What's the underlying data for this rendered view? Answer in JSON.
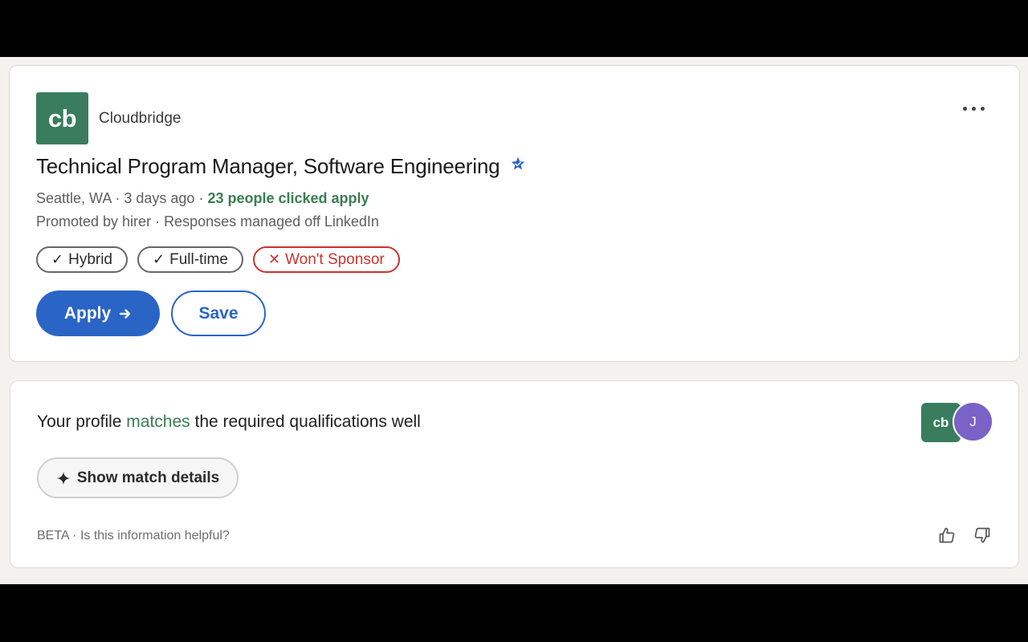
{
  "colors": {
    "brand_green": "#3a7d5e",
    "accent_green": "#3a7d52",
    "primary_blue": "#2a64c5",
    "negative_red": "#c8342f",
    "verified_blue": "#2a64c5",
    "user_avatar": "#7a62c6"
  },
  "job": {
    "logo_text": "cb",
    "company": "Cloudbridge",
    "title": "Technical Program Manager, Software Engineering",
    "location": "Seattle, WA",
    "separator": " · ",
    "posted": "3 days ago",
    "applicants": "23 people clicked apply",
    "promoted": "Promoted by hirer",
    "responses": "Responses managed off LinkedIn",
    "tags": [
      {
        "label": "Hybrid",
        "glyph": "✓",
        "kind": "positive"
      },
      {
        "label": "Full-time",
        "glyph": "✓",
        "kind": "positive"
      },
      {
        "label": "Won't Sponsor",
        "glyph": "✕",
        "kind": "negative"
      }
    ],
    "apply_label": "Apply",
    "save_label": "Save",
    "icons": {
      "verified": "verified-star-icon",
      "more": "more-horizontal-icon",
      "apply_arrow": "arrow-right-icon"
    }
  },
  "match": {
    "headline_pre": "Your profile ",
    "headline_highlight": "matches",
    "headline_post": " the required qualifications well",
    "company_avatar_text": "cb",
    "user_avatar_text": "J",
    "details_button_label": "Show match details",
    "beta_label": "BETA",
    "separator": " · ",
    "feedback_prompt": "Is this information helpful?",
    "icons": {
      "sparkle": "sparkle-icon",
      "thumbs_up": "thumbs-up-icon",
      "thumbs_down": "thumbs-down-icon"
    }
  }
}
